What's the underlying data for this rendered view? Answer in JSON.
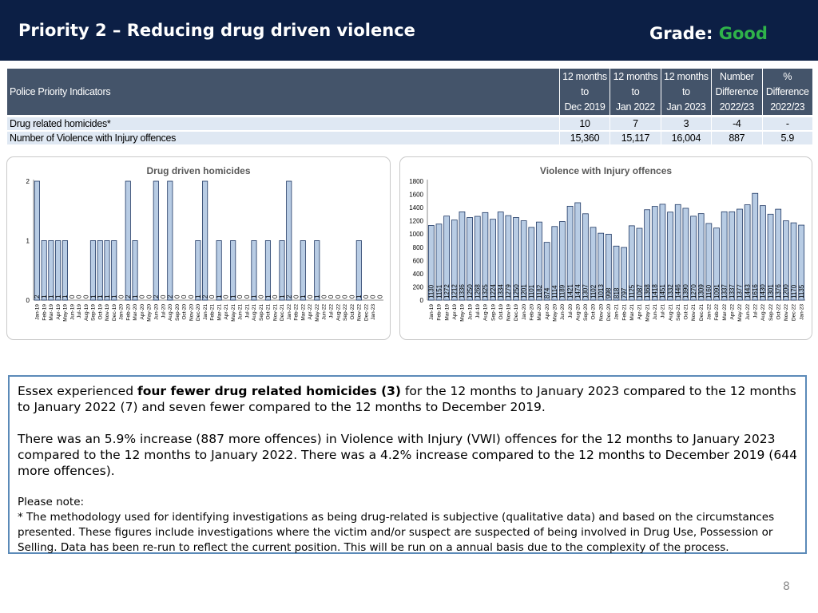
{
  "header": {
    "title": "Priority 2 – Reducing drug driven violence",
    "grade_label": "Grade:",
    "grade_value": "Good"
  },
  "table": {
    "headers": [
      [
        "Police Priority Indicators"
      ],
      [
        "12 months",
        "to",
        "Dec 2019"
      ],
      [
        "12 months",
        "to",
        "Jan 2022"
      ],
      [
        "12 months",
        "to",
        "Jan 2023"
      ],
      [
        "Number",
        "Difference",
        "2022/23"
      ],
      [
        "%",
        "Difference",
        "2022/23"
      ]
    ],
    "rows": [
      [
        "Drug related homicides*",
        "10",
        "7",
        "3",
        "-4",
        "-"
      ],
      [
        "Number of Violence with Injury offences",
        "15,360",
        "15,117",
        "16,004",
        "887",
        "5.9"
      ]
    ]
  },
  "chart_data": [
    {
      "type": "bar",
      "title": "Drug driven homicides",
      "ylim": [
        0,
        2
      ],
      "yticks": [
        0,
        1,
        2
      ],
      "categories": [
        "Jan-19",
        "Feb-19",
        "Mar-19",
        "Apr-19",
        "May-19",
        "Jun-19",
        "Jul-19",
        "Aug-19",
        "Sep-19",
        "Oct-19",
        "Nov-19",
        "Dec-19",
        "Jan-20",
        "Feb-20",
        "Mar-20",
        "Apr-20",
        "May-20",
        "Jun-20",
        "Jul-20",
        "Aug-20",
        "Sep-20",
        "Oct-20",
        "Nov-20",
        "Dec-20",
        "Jan-21",
        "Feb-21",
        "Mar-21",
        "Apr-21",
        "May-21",
        "Jun-21",
        "Jul-21",
        "Aug-21",
        "Sep-21",
        "Oct-21",
        "Nov-21",
        "Dec-21",
        "Jan-22",
        "Feb-22",
        "Mar-22",
        "Apr-22",
        "May-22",
        "Jun-22",
        "Jul-22",
        "Aug-22",
        "Sep-22",
        "Oct-22",
        "Nov-22",
        "Dec-22",
        "Jan-23"
      ],
      "values": [
        2,
        1,
        1,
        1,
        1,
        0,
        0,
        0,
        1,
        1,
        1,
        1,
        0,
        2,
        1,
        0,
        0,
        2,
        0,
        2,
        0,
        0,
        0,
        1,
        2,
        0,
        1,
        0,
        1,
        0,
        0,
        1,
        0,
        1,
        0,
        1,
        2,
        0,
        1,
        0,
        1,
        0,
        0,
        0,
        0,
        0,
        1,
        0,
        0,
        0
      ],
      "colors": {
        "bar": "#b8cce4",
        "stroke": "#1f3864"
      }
    },
    {
      "type": "bar",
      "title": "Violence with Injury offences",
      "ylim": [
        0,
        1800
      ],
      "yticks": [
        0,
        200,
        400,
        600,
        800,
        1000,
        1200,
        1400,
        1600,
        1800
      ],
      "categories": [
        "Jan-19",
        "Feb-19",
        "Mar-19",
        "Apr-19",
        "May-19",
        "Jun-19",
        "Jul-19",
        "Aug-19",
        "Sep-19",
        "Oct-19",
        "Nov-19",
        "Dec-19",
        "Jan-20",
        "Feb-20",
        "Mar-20",
        "Apr-20",
        "May-20",
        "Jun-20",
        "Jul-20",
        "Aug-20",
        "Sep-20",
        "Oct-20",
        "Nov-20",
        "Dec-20",
        "Jan-21",
        "Feb-21",
        "Mar-21",
        "Apr-21",
        "May-21",
        "Jun-21",
        "Jul-21",
        "Aug-21",
        "Sep-21",
        "Oct-21",
        "Nov-21",
        "Dec-21",
        "Jan-22",
        "Feb-22",
        "Mar-22",
        "Apr-22",
        "May-22",
        "Jun-22",
        "Jul-22",
        "Aug-22",
        "Sep-22",
        "Oct-22",
        "Nov-22",
        "Dec-22",
        "Jan-23"
      ],
      "values": [
        1130,
        1151,
        1272,
        1212,
        1336,
        1250,
        1268,
        1325,
        1224,
        1334,
        1279,
        1250,
        1201,
        1101,
        1182,
        874,
        1114,
        1189,
        1421,
        1474,
        1307,
        1102,
        1013,
        998,
        818,
        797,
        1125,
        1087,
        1368,
        1418,
        1451,
        1332,
        1446,
        1390,
        1270,
        1309,
        1160,
        1091,
        1337,
        1337,
        1377,
        1443,
        1616,
        1430,
        1301,
        1376,
        1200,
        1170,
        1135
      ],
      "colors": {
        "bar": "#b8cce4",
        "stroke": "#1f3864"
      }
    }
  ],
  "text": {
    "p1_a": "Essex experienced ",
    "p1_b": "four fewer drug related homicides (3)",
    "p1_c": " for the 12 months to January 2023 compared to the 12 months to January 2022 (7) and seven fewer compared to the 12 months to December 2019.",
    "p2": "There was an 5.9% increase (887 more offences) in Violence with Injury (VWI) offences for the 12 months to January 2023 compared to the 12 months to January 2022. There was a 4.2% increase compared to the 12 months to December 2019 (644 more offences).",
    "note_title": "Please note:",
    "note_body": "*   The methodology used for identifying investigations as being drug-related is subjective (qualitative data) and based on the circumstances presented. These figures include investigations where the victim and/or suspect are suspected of being involved in Drug Use, Possession or Selling. Data has been re-run to reflect the current position. This will be run on a annual basis due to the complexity of the process."
  },
  "page_number": "8"
}
